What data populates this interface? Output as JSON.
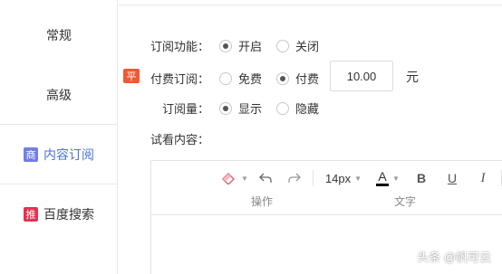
{
  "sidebar": {
    "items": [
      {
        "label": "常规"
      },
      {
        "label": "高级"
      },
      {
        "label": "内容订阅",
        "badge": "商",
        "badge_color": "#6f7ee6"
      },
      {
        "label": "百度搜索",
        "badge": "推",
        "badge_color": "#e2324f"
      }
    ],
    "active_color": "#4a73d1"
  },
  "form": {
    "subscribe": {
      "label": "订阅功能：",
      "options": [
        {
          "label": "开启",
          "selected": true
        },
        {
          "label": "关闭",
          "selected": false
        }
      ]
    },
    "paid": {
      "tag": "平",
      "tag_color": "#ef5a33",
      "label": "付费订阅：",
      "options": [
        {
          "label": "免费",
          "selected": false
        },
        {
          "label": "付费",
          "selected": true
        }
      ],
      "price": "10.00",
      "unit": "元"
    },
    "count": {
      "label": "订阅量：",
      "options": [
        {
          "label": "显示",
          "selected": true
        },
        {
          "label": "隐藏",
          "selected": false
        }
      ]
    },
    "preview": {
      "label": "试看内容："
    }
  },
  "editor": {
    "toolbar": {
      "font_size": "14px",
      "font_color_glyph": "A",
      "font_color": "#000000",
      "bold": "B",
      "underline": "U",
      "italic": "I",
      "groups": [
        {
          "label": "操作"
        },
        {
          "label": "文字"
        }
      ]
    }
  },
  "watermark": "头条 @帆可云"
}
